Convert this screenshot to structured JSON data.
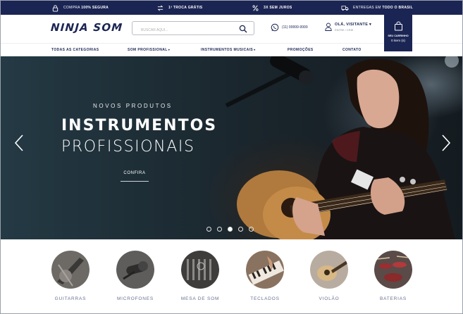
{
  "topbar": {
    "items": [
      {
        "prefix": "COMPRA",
        "bold": "100% SEGURA",
        "icon": "lock-icon"
      },
      {
        "prefix": "",
        "bold": "1ª TROCA GRÁTIS",
        "icon": "exchange-icon"
      },
      {
        "prefix": "",
        "bold": "3X SEM JUROS",
        "icon": "percent-icon"
      },
      {
        "prefix": "ENTREGAS EM",
        "bold": "TODO O BRASIL",
        "icon": "truck-icon"
      }
    ]
  },
  "header": {
    "logo": "NINJA SOM",
    "search_placeholder": "BUSCAR AQUI...",
    "phone": "(11) 99999-9999",
    "user_greeting": "OLÁ, VISITANTE",
    "user_sub": "ENTRE / CRIE",
    "cart_label": "SEU CARRINHO",
    "cart_count": "0 item (s)"
  },
  "nav": {
    "items": [
      {
        "label": "TODAS AS CATEGORIAS",
        "caret": ""
      },
      {
        "label": "SOM PROFISSIONAL",
        "caret": "▾"
      },
      {
        "label": "INSTRUMENTOS MUSICAIS",
        "caret": "▾"
      },
      {
        "label": "PROMOÇÕES",
        "caret": ""
      },
      {
        "label": "CONTATO",
        "caret": ""
      }
    ]
  },
  "hero": {
    "eyebrow": "NOVOS PRODUTOS",
    "title": "INSTRUMENTOS",
    "subtitle": "PROFISSIONAIS",
    "cta": "CONFIRA",
    "slides": 5,
    "active_slide": 3
  },
  "categories": [
    {
      "label": "GUITARRAS"
    },
    {
      "label": "MICROFONES"
    },
    {
      "label": "MESA DE SOM"
    },
    {
      "label": "TECLADOS"
    },
    {
      "label": "VIOLÃO"
    },
    {
      "label": "BATERIAS"
    }
  ],
  "colors": {
    "brand": "#1b2553",
    "muted": "#6a7190"
  }
}
